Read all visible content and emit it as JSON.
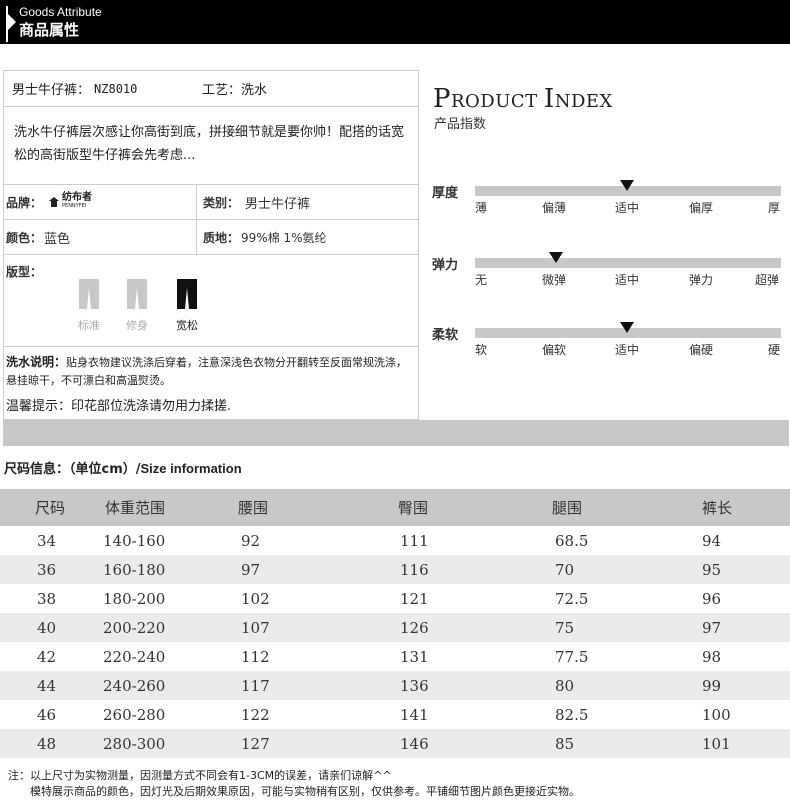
{
  "header": {
    "title_en": "Goods Attribute",
    "title_cn": "商品属性"
  },
  "product": {
    "name_label": "男士牛仔裤：",
    "name_value": "NZ8010",
    "craft_label": "工艺：",
    "craft_value": "洗水",
    "description": "洗水牛仔裤层次感让你高街到底，拼接细节就是要你帅！配搭的话宽松的高街版型牛仔裤会先考虑...",
    "brand_label": "品牌：",
    "brand_name_cn": "纺布者",
    "brand_name_en": "PENNYFEI",
    "category_label": "类别：",
    "category_value": "男士牛仔裤",
    "color_label": "颜色：",
    "color_value": "蓝色",
    "material_label": "质地：",
    "material_value": "99%棉 1%氨纶",
    "fit_label": "版型：",
    "fits": [
      {
        "label": "标准",
        "selected": false
      },
      {
        "label": "修身",
        "selected": false
      },
      {
        "label": "宽松",
        "selected": true
      }
    ],
    "wash_label": "洗水说明：",
    "wash_text": "贴身衣物建议洗涤后穿着，注意深浅色衣物分开翻转至反面常规洗涤，悬挂晾干，不可漂白和高温熨烫。",
    "tip": "温馨提示：印花部位洗涤请勿用力揉搓."
  },
  "product_index": {
    "title": "PRODUCT INDEX",
    "subtitle": "产品指数",
    "meters": [
      {
        "label": "厚度",
        "ticks": [
          "薄",
          "偏薄",
          "适中",
          "偏厚",
          "厚"
        ],
        "selected_index": 2
      },
      {
        "label": "弹力",
        "ticks": [
          "无",
          "微弹",
          "适中",
          "弹力",
          "超弹"
        ],
        "selected_index": 1
      },
      {
        "label": "柔软",
        "ticks": [
          "软",
          "偏软",
          "适中",
          "偏硬",
          "硬"
        ],
        "selected_index": 2
      }
    ]
  },
  "size": {
    "heading_cn": "尺码信息：（单位cm）/",
    "heading_en": "Size information",
    "columns": [
      "尺码",
      "体重范围",
      "腰围",
      "臀围",
      "腿围",
      "裤长"
    ],
    "rows": [
      [
        "34",
        "140-160",
        "92",
        "111",
        "68.5",
        "94"
      ],
      [
        "36",
        "160-180",
        "97",
        "116",
        "70",
        "95"
      ],
      [
        "38",
        "180-200",
        "102",
        "121",
        "72.5",
        "96"
      ],
      [
        "40",
        "200-220",
        "107",
        "126",
        "75",
        "97"
      ],
      [
        "42",
        "220-240",
        "112",
        "131",
        "77.5",
        "98"
      ],
      [
        "44",
        "240-260",
        "117",
        "136",
        "80",
        "99"
      ],
      [
        "46",
        "260-280",
        "122",
        "141",
        "82.5",
        "100"
      ],
      [
        "48",
        "280-300",
        "127",
        "146",
        "85",
        "101"
      ]
    ]
  },
  "notes": {
    "line1": "注：以上尺寸为实物测量，因测量方式不同会有1-3CM的误差，请亲们谅解^^",
    "line2": "模特展示商品的颜色，因灯光及后期效果原因，可能与实物稍有区别，仅供参考。平铺细节图片颜色更接近实物。"
  }
}
